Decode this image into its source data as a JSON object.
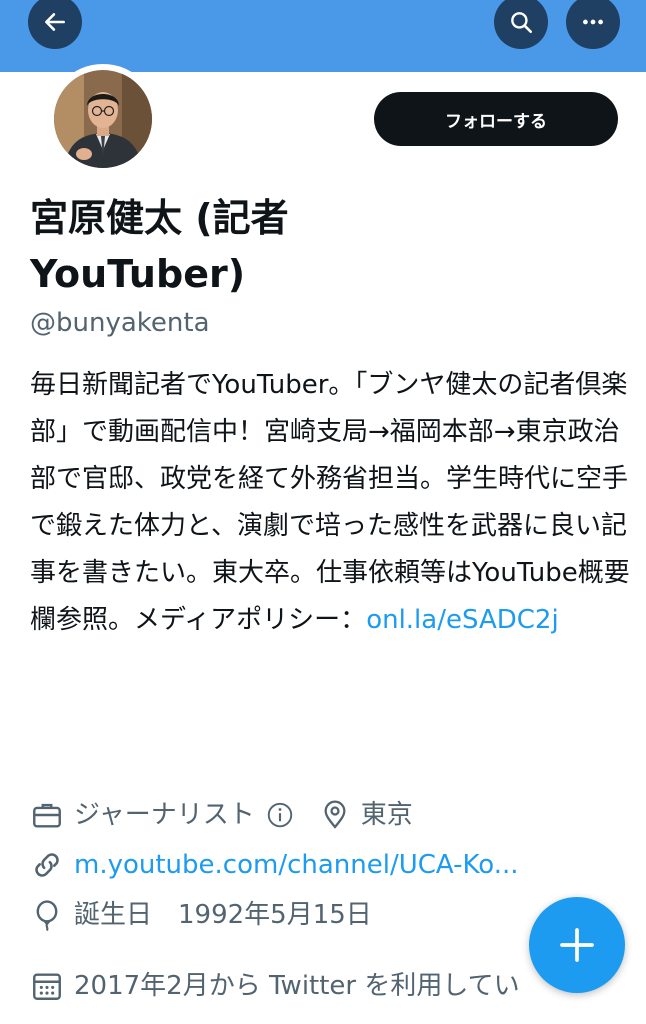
{
  "header": {
    "back_icon": "arrow-left-icon",
    "search_icon": "search-icon",
    "more_icon": "more-horizontal-icon",
    "banner_color": "#4a99e9"
  },
  "profile": {
    "name": "宮原健太 (記者YouTuber)",
    "handle": "@bunyakenta",
    "follow_label": "フォローする",
    "bio_text": "毎日新聞記者でYouTuber。「ブンヤ健太の記者倶楽部」で動画配信中！宮崎支局→福岡本部→東京政治部で官邸、政党を経て外務省担当。学生時代に空手で鍛えた体力と、演劇で培った感性を武器に良い記事を書きたい。東大卒。仕事依頼等はYouTube概要欄参照。メディアポリシー：",
    "bio_link": "onl.la/eSADC2j",
    "profession": "ジャーナリスト",
    "location": "東京",
    "website": "m.youtube.com/channel/UCA-Ko...",
    "birthday": "誕生日　1992年5月15日",
    "joined": "2017年2月から Twitter を利用してい"
  },
  "fab": {
    "icon": "plus-icon",
    "color": "#1d9bf0"
  }
}
